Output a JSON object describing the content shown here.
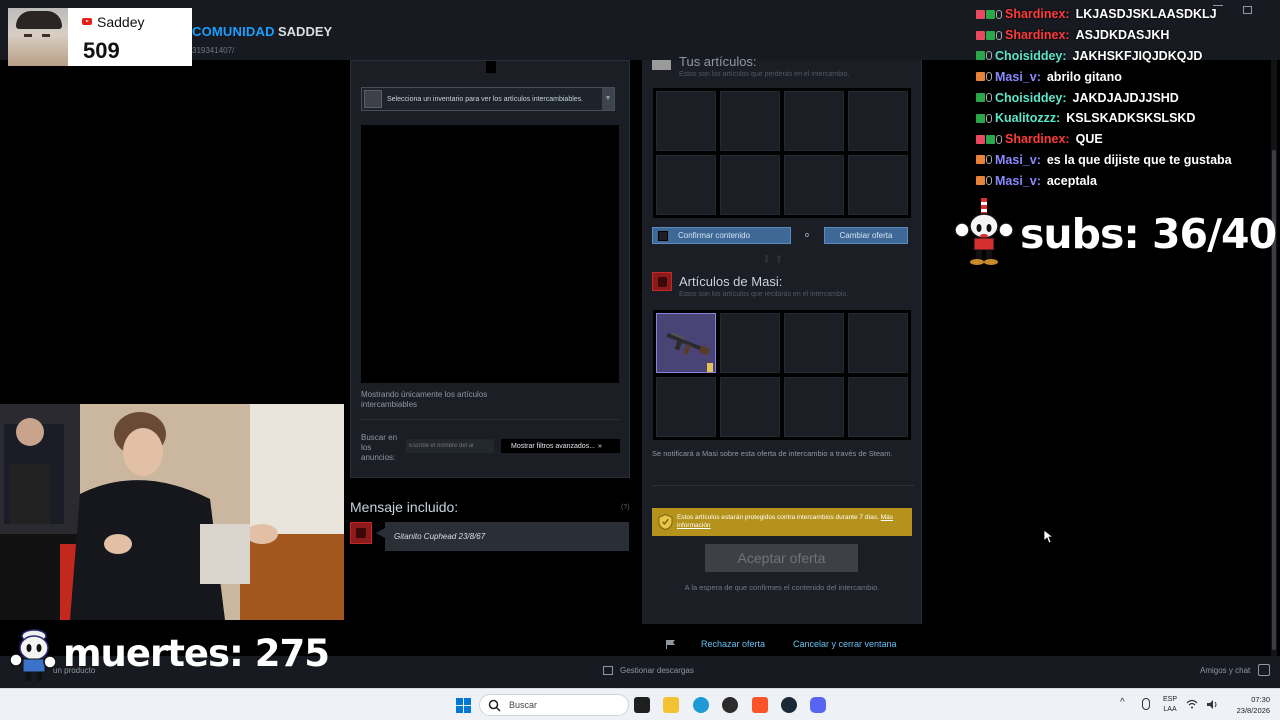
{
  "steam": {
    "nav_comunidad": "COMUNIDAD",
    "nav_user": "SADDEY",
    "url_fragment": "319341407/"
  },
  "inventory": {
    "select_text": "Selecciona un inventario para ver los artículos intercambiables.",
    "showing_text": "Mostrando únicamente los artículos intercambiables",
    "search_label": "Buscar en los anuncios:",
    "search_placeholder": "Escribe el nombre del ar",
    "filter_button": "Mostrar filtros avanzados...",
    "filter_chevron": "»"
  },
  "message": {
    "title": "Mensaje incluido:",
    "help": "(?)",
    "text": "Gitanito Cuphead 23/8/67"
  },
  "trade": {
    "my_title": "Tus artículos:",
    "my_subtitle": "Estos son los artículos que perderás en el intercambio.",
    "confirm_label": "Confirmar contenido",
    "or": "o",
    "change_offer": "Cambiar oferta",
    "their_title": "Artículos de Masi:",
    "their_subtitle": "Estos son los artículos que recibirás en el intercambio.",
    "notify_text": "Se notificará a Masi sobre esta oferta de intercambio a través de Steam.",
    "protect_text": "Estos artículos estarán protegidos contra intercambios durante 7 días.",
    "protect_link": "Más información",
    "accept_button": "Aceptar oferta",
    "waiting_text": "A la espera de que confirmes el contenido del intercambio.",
    "reject_link": "Rechazar oferta",
    "cancel_link": "Cancelar y cerrar ventana"
  },
  "status_bar": {
    "product": "un producto",
    "downloads": "Gestionar descargas",
    "friends": "Amigos y chat"
  },
  "overlay": {
    "channel_name": "Saddey",
    "subscriber_count": "509",
    "subs_goal": "subs: 36/40",
    "deaths": "muertes: 275"
  },
  "chat": [
    {
      "user": "Shardinex",
      "message": "LKJASDJSKLAASDKLJ",
      "color": "#ff3b3b"
    },
    {
      "user": "Shardinex",
      "message": "ASJDKDASJKH",
      "color": "#ff3b3b"
    },
    {
      "user": "Choisiddey",
      "message": "JAKHSKFJIQJDKQJD",
      "color": "#5ce6c8"
    },
    {
      "user": "Masi_v",
      "message": "abrilo gitano",
      "color": "#8a8aff"
    },
    {
      "user": "Choisiddey",
      "message": "JAKDJAJDJJSHD",
      "color": "#5ce6c8"
    },
    {
      "user": "Kualitozzz",
      "message": "KSLSKADKSKSLSKD",
      "color": "#5ce6c8"
    },
    {
      "user": "Shardinex",
      "message": "QUE",
      "color": "#ff3b3b"
    },
    {
      "user": "Masi_v",
      "message": "es la que dijiste que te gustaba",
      "color": "#8a8aff"
    },
    {
      "user": "Masi_v",
      "message": "aceptala",
      "color": "#8a8aff"
    }
  ],
  "taskbar": {
    "search_placeholder": "Buscar",
    "lang_top": "ESP",
    "lang_bottom": "LAA",
    "time": "07:30",
    "date": "23/8/2026"
  },
  "colors": {
    "steam_blue": "#1a9fff",
    "link_blue": "#66c0f4",
    "button_blue": "#3e6896",
    "protect_gold": "#b5921b",
    "item_purple": "#4a4476"
  }
}
